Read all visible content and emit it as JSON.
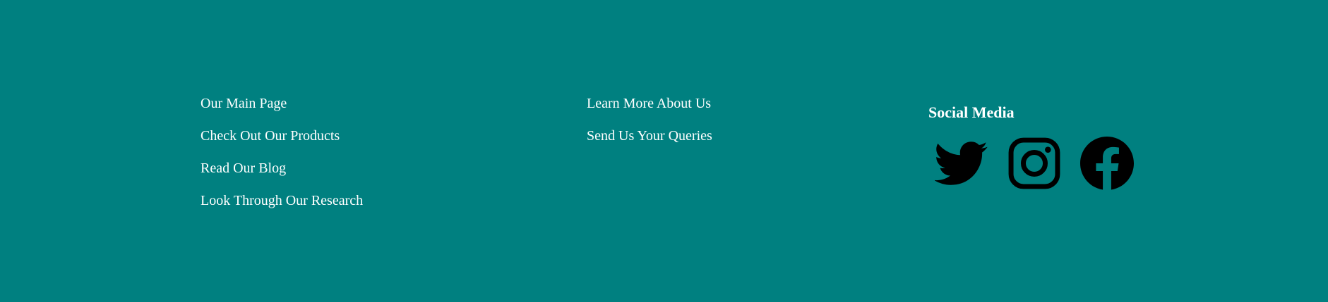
{
  "footer": {
    "column_one": [
      {
        "label": "Our Main Page"
      },
      {
        "label": "Check Out Our Products"
      },
      {
        "label": "Read Our Blog"
      },
      {
        "label": "Look Through Our Research"
      }
    ],
    "column_two": [
      {
        "label": "Learn More About Us"
      },
      {
        "label": "Send Us Your Queries"
      }
    ],
    "social": {
      "title": "Social Media",
      "icons": [
        "twitter-icon",
        "instagram-icon",
        "facebook-icon"
      ]
    }
  },
  "colors": {
    "background": "#008080",
    "text": "#ffffff",
    "icon": "#000000"
  }
}
